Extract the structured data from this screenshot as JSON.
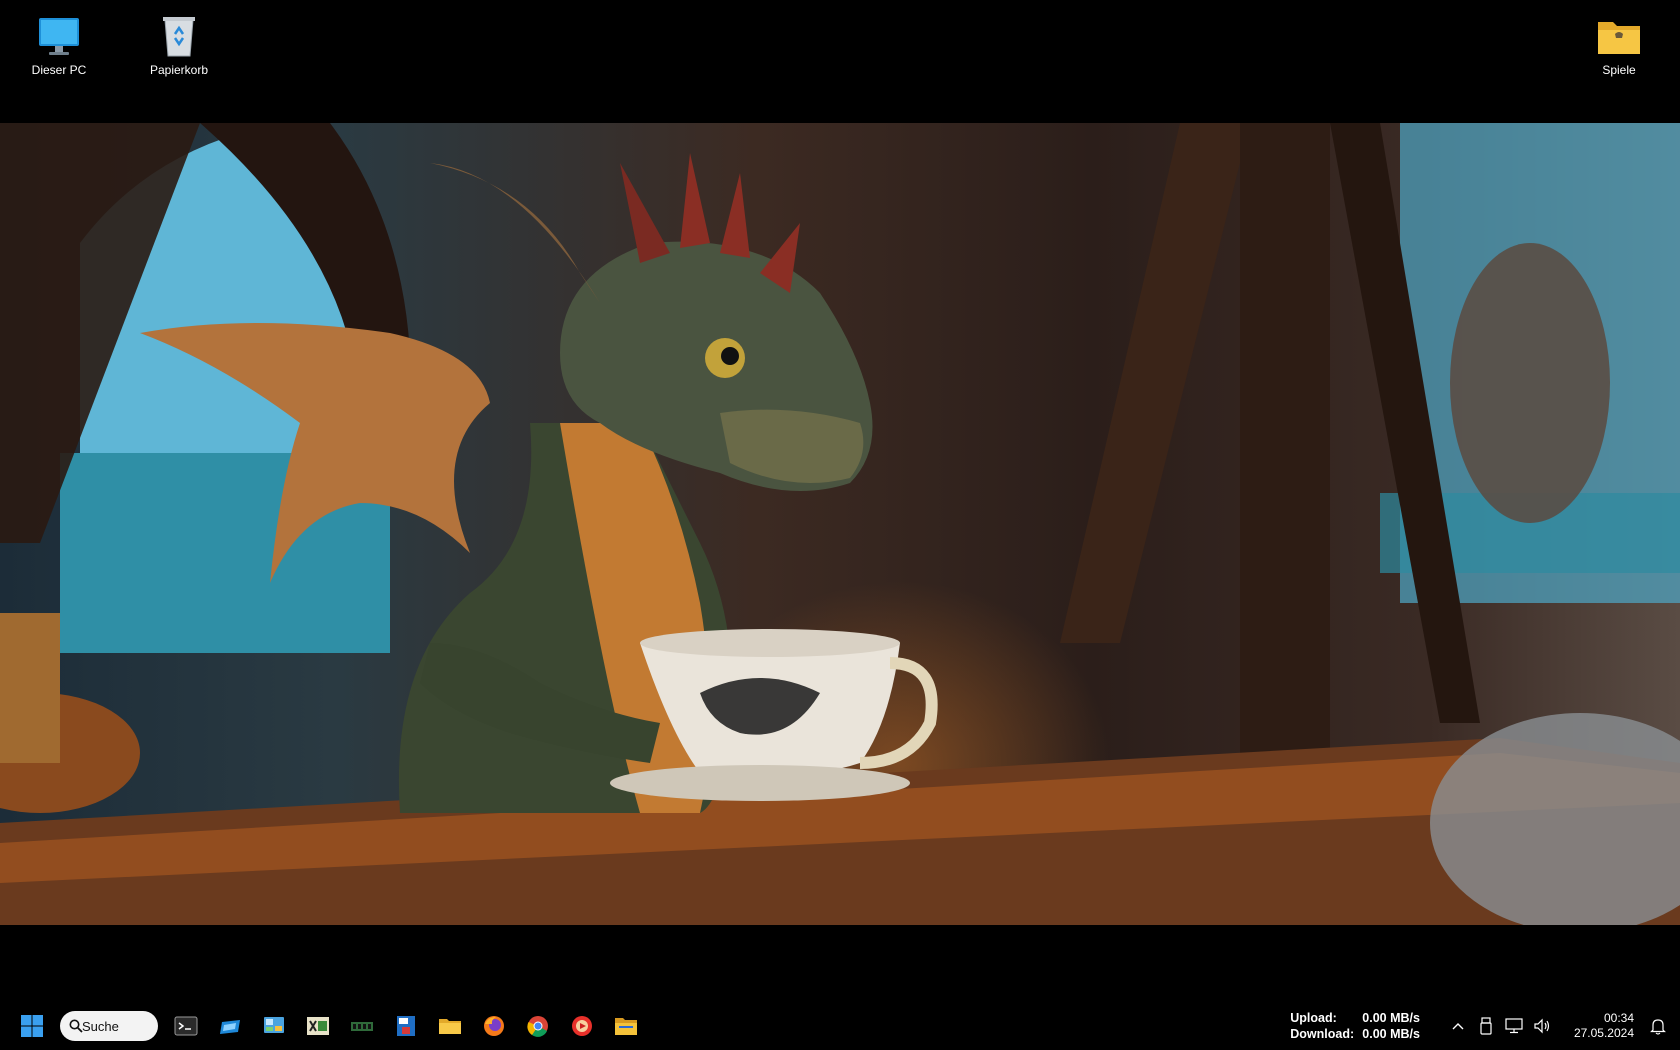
{
  "desktop": {
    "icons": [
      {
        "label": "Dieser PC"
      },
      {
        "label": "Papierkorb"
      },
      {
        "label": "Spiele"
      }
    ]
  },
  "taskbar": {
    "search_label": "Suche",
    "pinned": [
      {
        "icon": "terminal-icon"
      },
      {
        "icon": "snipping-icon"
      },
      {
        "icon": "control-panel-icon"
      },
      {
        "icon": "xd-app-icon"
      },
      {
        "icon": "memory-module-icon"
      },
      {
        "icon": "id-card-app-icon"
      },
      {
        "icon": "file-explorer-icon"
      },
      {
        "icon": "firefox-icon"
      },
      {
        "icon": "chrome-icon"
      },
      {
        "icon": "media-player-icon"
      },
      {
        "icon": "folder-app-icon"
      }
    ]
  },
  "tray": {
    "upload_label": "Upload:",
    "upload_value": "0.00 MB/s",
    "download_label": "Download:",
    "download_value": "0.00 MB/s",
    "time": "00:34",
    "date": "27.05.2024"
  },
  "colors": {
    "taskbar_bg": "#000000",
    "accent_blue": "#0078d4"
  }
}
